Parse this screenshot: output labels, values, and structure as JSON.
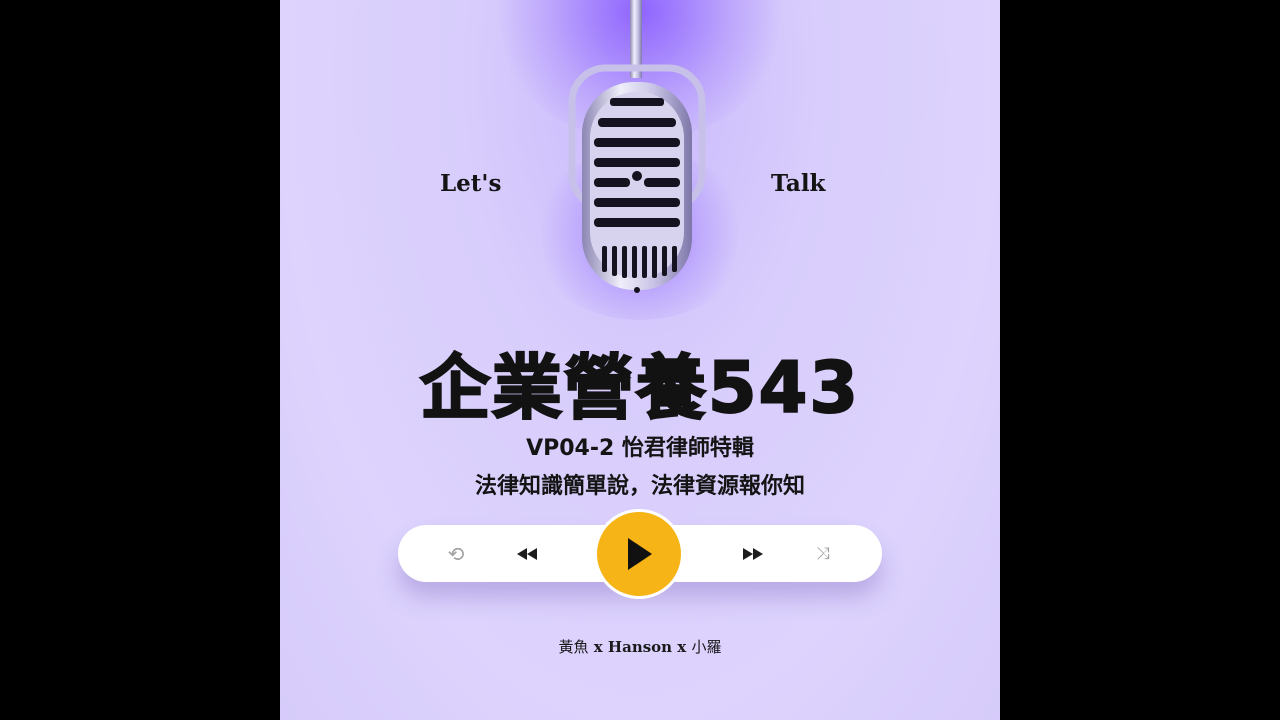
{
  "cover": {
    "lets": "Let's",
    "talk": "Talk",
    "title": "企業營養543",
    "episode_line": "VP04-2 怡君律師特輯",
    "tagline": "法律知識簡單說，法律資源報你知",
    "credits": {
      "host1": "黃魚",
      "sep1": " x ",
      "host2": "Hanson",
      "sep2": " x ",
      "host3": "小羅"
    }
  },
  "player": {
    "repeat_icon": "repeat-icon",
    "prev_icon": "rewind-icon",
    "play_icon": "play-icon",
    "next_icon": "fast-forward-icon",
    "shuffle_icon": "shuffle-icon",
    "play_color": "#f6b417"
  },
  "colors": {
    "background": "#dcd2fc",
    "glow": "#7a46ff",
    "text": "#141414"
  }
}
